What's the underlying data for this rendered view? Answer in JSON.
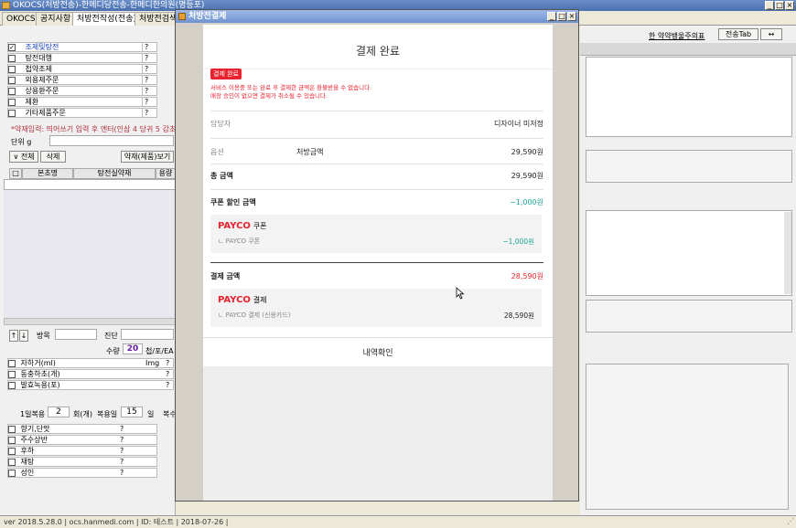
{
  "app": {
    "title": "OKOCS(처방전송)-한메디당전송-한메디한의원(명등포)",
    "tabs": [
      "OKOCS",
      "공지사항",
      "처방전작성(전송)",
      "처방전검색"
    ],
    "active_tab": 2
  },
  "left": {
    "options": [
      {
        "label": "조제및탕전",
        "checked": true,
        "q": "?"
      },
      {
        "label": "탕전대행",
        "checked": false,
        "q": "?"
      },
      {
        "label": "첩약조제",
        "checked": false,
        "q": "?"
      },
      {
        "label": "외용제주문",
        "checked": false,
        "q": "?"
      },
      {
        "label": "상용환주문",
        "checked": false,
        "q": "?"
      },
      {
        "label": "제환",
        "checked": false,
        "q": "?"
      },
      {
        "label": "기타제품주문",
        "checked": false,
        "q": "?"
      }
    ],
    "hint": "*약재입력: 띄어쓰기 입력 후 엔터(인삼 4 당귀 5 감초",
    "unit_label": "단위 g",
    "btn_all": "∨ 전체",
    "btn_delete": "삭제",
    "btn_herb_view": "약재(제품)보기",
    "grid_headers": [
      "□",
      "본초명",
      "탕전실약재",
      "용량"
    ],
    "pack_label": "방목",
    "jindan_label": "진단",
    "qty_label": "수량",
    "qty_value": "20",
    "qty_unit": "첩/포/EA",
    "extras": [
      {
        "label": "자하거(ml)",
        "unit": "Img",
        "q": "?"
      },
      {
        "label": "동충하초(개)",
        "q": "?"
      },
      {
        "label": "발효녹용(포)",
        "q": "?"
      }
    ],
    "dose_label": "1일복용",
    "dose_value": "2",
    "dose_unit": "회(개)",
    "days_label": "복용일",
    "days_value": "15",
    "days_unit": "일",
    "extra_col": "복수",
    "flavors": [
      {
        "label": "향기,단맛",
        "q": "?"
      },
      {
        "label": "주수상반",
        "q": "?"
      },
      {
        "label": "후하",
        "q": "?"
      },
      {
        "label": "재탕",
        "q": "?"
      },
      {
        "label": "성인",
        "q": "?"
      }
    ]
  },
  "right": {
    "link": "한 약약뱅울주의표",
    "transfer_tab": "전송Tab",
    "arrows": "↔"
  },
  "status": {
    "text": "ver 2018.5.28.0  |  ocs.hanmedi.com  |  ID: 테스트  |  2018-07-26  |"
  },
  "modal": {
    "window_title": "처방전결제",
    "heading": "결제 완료",
    "badge": "결제 완료",
    "notice_line1": "서비스 이용중 또는 완료 후 결제한 금액은 환불받을 수 없습니다.",
    "notice_line2": "매장 승인이 없으면 결제가 취소될 수 있습니다.",
    "manager_label": "담당자",
    "manager_value": "디자이너 미저정",
    "option_label": "옵션",
    "option_name": "처방금액",
    "option_value": "29,590원",
    "total_label": "총 금액",
    "total_value": "29,590원",
    "coupon_label": "쿠폰 할인 금액",
    "coupon_value": "−1,000원",
    "coupon_box": {
      "brand": "PAYCO",
      "title": "쿠폰",
      "sub": "ㄴ PAYCO 쿠폰",
      "amount": "−1,000원"
    },
    "pay_label": "결제 금액",
    "pay_value": "28,590원",
    "pay_box": {
      "brand": "PAYCO",
      "title": "결제",
      "sub": "ㄴ PAYCO 결제 (신용카드)",
      "amount": "28,590원"
    },
    "confirm_button": "내역확인",
    "colors": {
      "red": "#e8222e",
      "teal": "#1aa59a"
    }
  }
}
